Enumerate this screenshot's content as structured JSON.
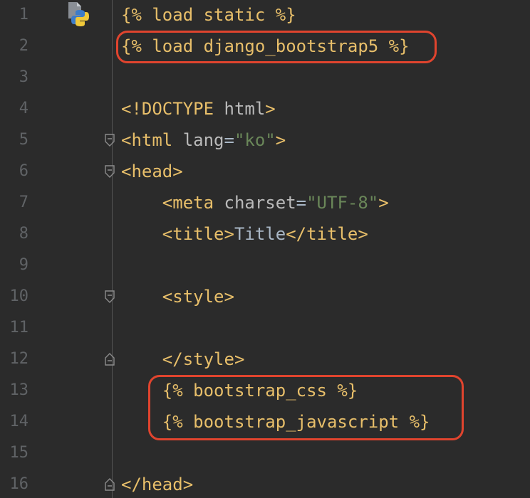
{
  "editor": {
    "file_icon": "python-django-template-icon",
    "lines": [
      {
        "num": "1",
        "tokens": [
          {
            "t": "{% load static %}",
            "c": "tpl"
          }
        ]
      },
      {
        "num": "2",
        "tokens": [
          {
            "t": "{% load django_bootstrap5 %}",
            "c": "tpl"
          }
        ]
      },
      {
        "num": "3",
        "tokens": []
      },
      {
        "num": "4",
        "tokens": [
          {
            "t": "<!DOCTYPE ",
            "c": "tag"
          },
          {
            "t": "html",
            "c": "attr"
          },
          {
            "t": ">",
            "c": "tag"
          }
        ]
      },
      {
        "num": "5",
        "tokens": [
          {
            "t": "<html ",
            "c": "tag"
          },
          {
            "t": "lang",
            "c": "attr"
          },
          {
            "t": "=",
            "c": "txt"
          },
          {
            "t": "\"ko\"",
            "c": "str"
          },
          {
            "t": ">",
            "c": "tag"
          }
        ]
      },
      {
        "num": "6",
        "tokens": [
          {
            "t": "<head>",
            "c": "tag"
          }
        ]
      },
      {
        "num": "7",
        "tokens": [
          {
            "t": "    <meta ",
            "c": "tag"
          },
          {
            "t": "charset",
            "c": "attr"
          },
          {
            "t": "=",
            "c": "txt"
          },
          {
            "t": "\"UTF-8\"",
            "c": "str"
          },
          {
            "t": ">",
            "c": "tag"
          }
        ]
      },
      {
        "num": "8",
        "tokens": [
          {
            "t": "    <title>",
            "c": "tag"
          },
          {
            "t": "Title",
            "c": "txt"
          },
          {
            "t": "</title>",
            "c": "tag"
          }
        ]
      },
      {
        "num": "9",
        "tokens": []
      },
      {
        "num": "10",
        "tokens": [
          {
            "t": "    <style>",
            "c": "tag"
          }
        ]
      },
      {
        "num": "11",
        "tokens": []
      },
      {
        "num": "12",
        "tokens": [
          {
            "t": "    </style>",
            "c": "tag"
          }
        ]
      },
      {
        "num": "13",
        "tokens": [
          {
            "t": "    {% bootstrap_css %}",
            "c": "tpl"
          }
        ]
      },
      {
        "num": "14",
        "tokens": [
          {
            "t": "    {% bootstrap_javascript %}",
            "c": "tpl"
          }
        ]
      },
      {
        "num": "15",
        "tokens": []
      },
      {
        "num": "16",
        "tokens": [
          {
            "t": "</head>",
            "c": "tag"
          }
        ]
      }
    ],
    "fold_markers": {
      "5": "open",
      "6": "open",
      "10": "open",
      "12": "close",
      "16": "close"
    },
    "highlight_color": "#e0442e"
  }
}
